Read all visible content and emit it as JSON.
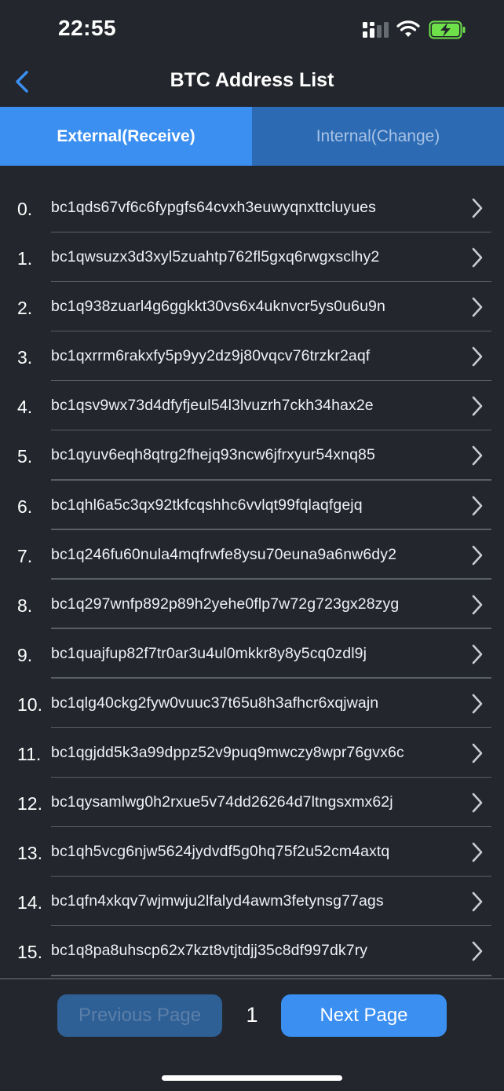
{
  "status_bar": {
    "time": "22:55"
  },
  "nav": {
    "title": "BTC Address List"
  },
  "tabs": [
    {
      "label": "External(Receive)",
      "active": true
    },
    {
      "label": "Internal(Change)",
      "active": false
    }
  ],
  "addresses": [
    {
      "index": "0.",
      "address": "bc1qds67vf6c6fypgfs64cvxh3euwyqnxttcluyues"
    },
    {
      "index": "1.",
      "address": "bc1qwsuzx3d3xyl5zuahtp762fl5gxq6rwgxsclhy2"
    },
    {
      "index": "2.",
      "address": "bc1q938zuarl4g6ggkkt30vs6x4uknvcr5ys0u6u9n"
    },
    {
      "index": "3.",
      "address": "bc1qxrrm6rakxfy5p9yy2dz9j80vqcv76trzkr2aqf"
    },
    {
      "index": "4.",
      "address": "bc1qsv9wx73d4dfyfjeul54l3lvuzrh7ckh34hax2e"
    },
    {
      "index": "5.",
      "address": "bc1qyuv6eqh8qtrg2fhejq93ncw6jfrxyur54xnq85"
    },
    {
      "index": "6.",
      "address": "bc1qhl6a5c3qx92tkfcqshhc6vvlqt99fqlaqfgejq"
    },
    {
      "index": "7.",
      "address": "bc1q246fu60nula4mqfrwfe8ysu70euna9a6nw6dy2"
    },
    {
      "index": "8.",
      "address": "bc1q297wnfp892p89h2yehe0flp7w72g723gx28zyg"
    },
    {
      "index": "9.",
      "address": "bc1quajfup82f7tr0ar3u4ul0mkkr8y8y5cq0zdl9j"
    },
    {
      "index": "10.",
      "address": "bc1qlg40ckg2fyw0vuuc37t65u8h3afhcr6xqjwajn"
    },
    {
      "index": "11.",
      "address": "bc1qgjdd5k3a99dppz52v9puq9mwczy8wpr76gvx6c"
    },
    {
      "index": "12.",
      "address": "bc1qysamlwg0h2rxue5v74dd26264d7ltngsxmx62j"
    },
    {
      "index": "13.",
      "address": "bc1qh5vcg6njw5624jydvdf5g0hq75f2u52cm4axtq"
    },
    {
      "index": "14.",
      "address": "bc1qfn4xkqv7wjmwju2lfalyd4awm3fetynsg77ags"
    },
    {
      "index": "15.",
      "address": "bc1q8pa8uhscp62x7kzt8vtjtdjj35c8df997dk7ry"
    }
  ],
  "pagination": {
    "prev_label": "Previous Page",
    "page_number": "1",
    "next_label": "Next Page"
  },
  "colors": {
    "background": "#23262c",
    "accent": "#3b8ff0",
    "tab_inactive": "#2c6bb3",
    "battery": "#6ee04a"
  }
}
